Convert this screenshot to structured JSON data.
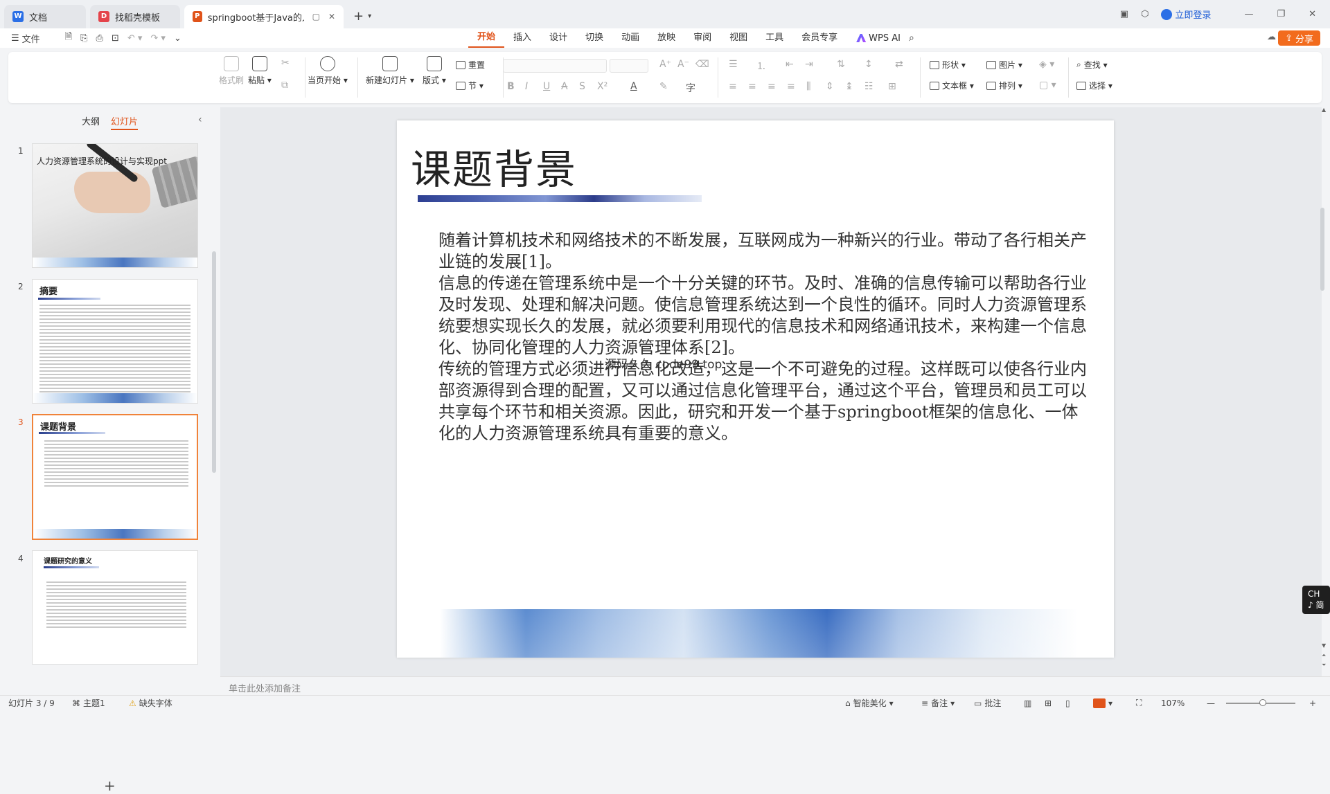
{
  "titlebar": {
    "tabs": [
      {
        "label": "文档",
        "color": "#2b6fe6",
        "glyph": "W"
      },
      {
        "label": "找稻壳模板",
        "color": "#e4434a",
        "glyph": "D"
      },
      {
        "label": "springboot基于Java的人力",
        "color": "#e0531a",
        "glyph": "P"
      }
    ],
    "new_tab": "+",
    "login": "立即登录"
  },
  "menubar": {
    "file": "文件",
    "tabs": [
      "开始",
      "插入",
      "设计",
      "切换",
      "动画",
      "放映",
      "审阅",
      "视图",
      "工具",
      "会员专享"
    ],
    "active_tab": "开始",
    "wps_ai": "WPS AI",
    "share": "分享"
  },
  "ribbon": {
    "format_painter": "格式刷",
    "paste": "粘贴",
    "play_from_current": "当页开始",
    "new_slide": "新建幻灯片",
    "layout": "版式",
    "reset": "重置",
    "section": "节",
    "shape": "形状",
    "image": "图片",
    "textbox": "文本框",
    "arrange": "排列",
    "find": "查找",
    "select": "选择"
  },
  "left_panel": {
    "tab_outline": "大纲",
    "tab_slides": "幻灯片",
    "active": "幻灯片",
    "thumbnails": [
      {
        "num": "1",
        "title": "人力资源管理系统的设计与实现ppt"
      },
      {
        "num": "2",
        "title": "摘要"
      },
      {
        "num": "3",
        "title": "课题背景"
      },
      {
        "num": "4",
        "title": "课题研究的意义"
      }
    ],
    "add": "+"
  },
  "slide": {
    "title": "课题背景",
    "paragraphs": [
      "随着计算机技术和网络技术的不断发展，互联网成为一种新兴的行业。带动了各行相关产业链的发展[1]。",
      "信息的传递在管理系统中是一个十分关键的环节。及时、准确的信息传输可以帮助各行业及时发现、处理和解决问题。使信息管理系统达到一个良性的循环。同时人力资源管理系统要想实现长久的发展，就必须要利用现代的信息技术和网络通讯技术，来构建一个信息化、协同化管理的人力资源管理体系[2]。",
      "传统的管理方式必须进行信息化改造，这是一个不可避免的过程。这样既可以使各行业内部资源得到合理的配置，又可以通过信息化管理平台，通过这个平台，管理员和员工可以共享每个环节和相关资源。因此，研究和开发一个基于springboot框架的信息化、一体化的人力资源管理系统具有重要的意义。"
    ],
    "watermark": "源码久久 code99.top"
  },
  "ime": "CH ♪ 简",
  "notes_placeholder": "单击此处添加备注",
  "statusbar": {
    "slide_pos": "幻灯片 3 / 9",
    "theme": "主题1",
    "missing_font": "缺失字体",
    "beautify": "智能美化",
    "notes": "备注",
    "comments": "批注",
    "zoom": "107%"
  }
}
